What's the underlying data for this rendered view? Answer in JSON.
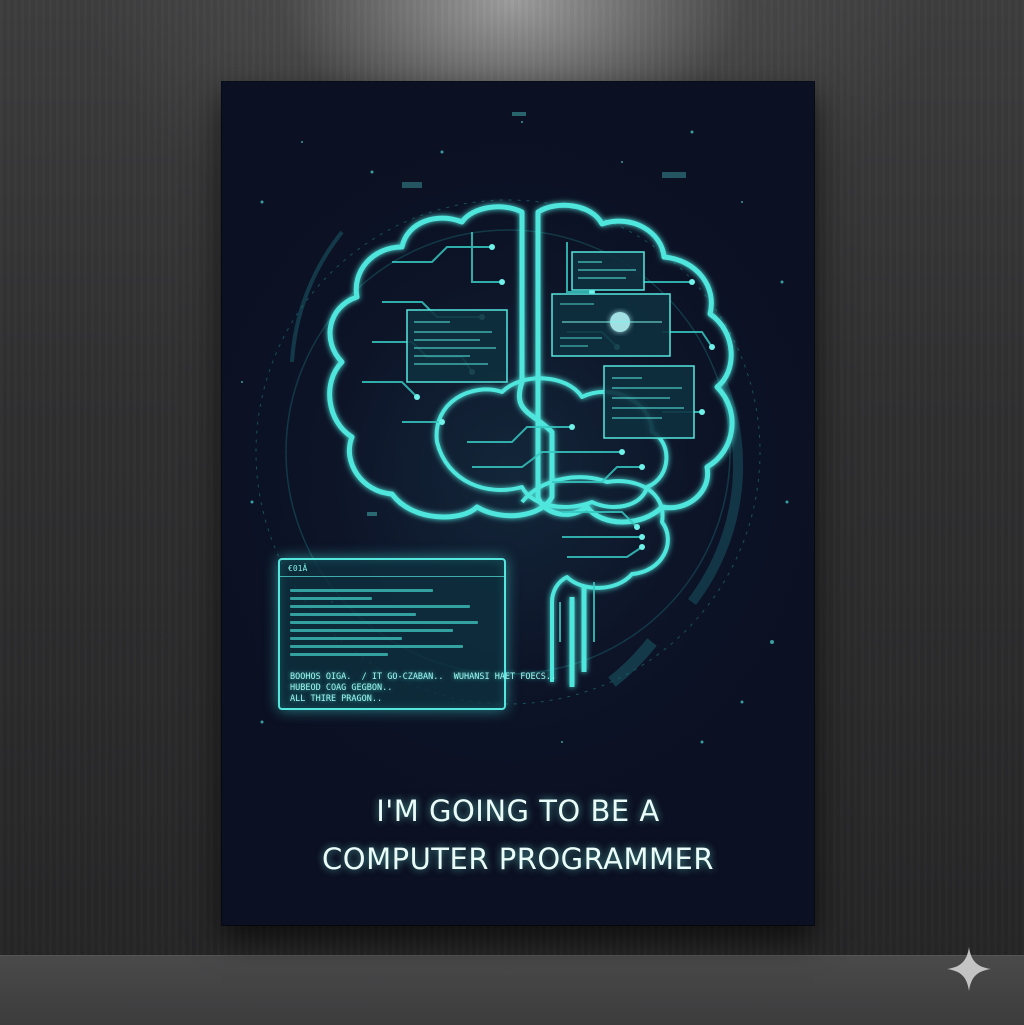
{
  "poster": {
    "headline_line1": "I'M GOING TO BE A",
    "headline_line2": "COMPUTER PROGRAMMER",
    "terminal": {
      "title": "€01Â",
      "output_lines": [
        "BOOHOS OIGA.  / IT GO-CZABAN..  WUHANSI HAET FOECS..",
        "HUBEOD COAG GEGBON..",
        "ALL THIRE PRAGON.."
      ]
    }
  },
  "colors": {
    "glow": "#4fe6dd",
    "poster_bg": "#0d1428",
    "wall": "#303031"
  },
  "icons": {
    "corner": "sparkle-icon"
  }
}
